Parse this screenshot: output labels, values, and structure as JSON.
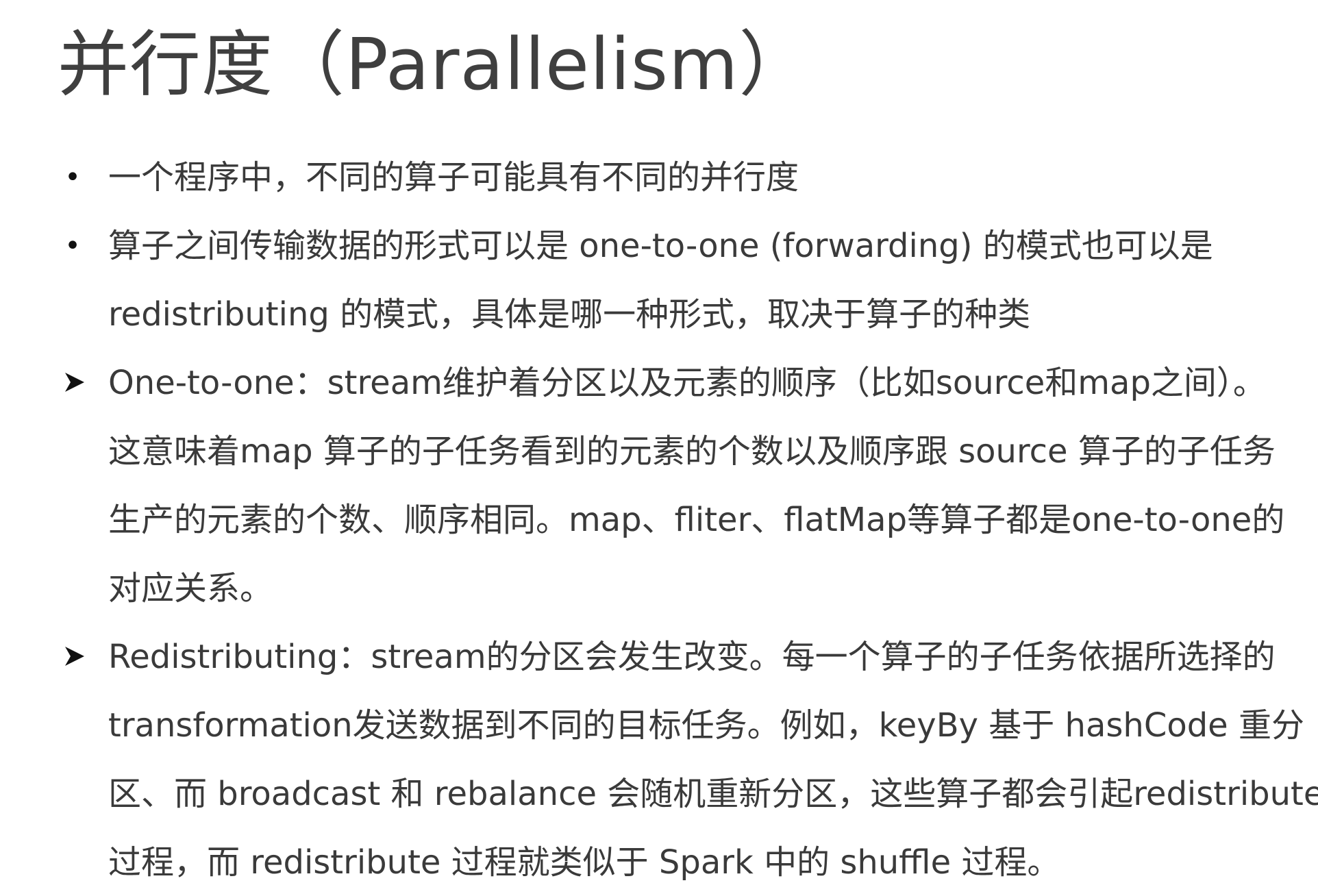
{
  "title": "并行度（Parallelism）",
  "items": [
    {
      "marker": "•",
      "lines": [
        "一个程序中，不同的算子可能具有不同的并行度"
      ]
    },
    {
      "marker": "•",
      "lines": [
        "算子之间传输数据的形式可以是 one-to-one (forwarding) 的模式也可以是",
        "redistributing 的模式，具体是哪一种形式，取决于算子的种类"
      ]
    },
    {
      "marker": "➢",
      "lines": [
        "One-to-one：stream维护着分区以及元素的顺序（比如source和map之间）。",
        "这意味着map 算子的子任务看到的元素的个数以及顺序跟 source 算子的子任务",
        "生产的元素的个数、顺序相同。map、fliter、flatMap等算子都是one-to-one的",
        "对应关系。"
      ]
    },
    {
      "marker": "➢",
      "lines": [
        "Redistributing：stream的分区会发生改变。每一个算子的子任务依据所选择的",
        "transformation发送数据到不同的目标任务。例如，keyBy 基于 hashCode 重分",
        "区、而 broadcast 和 rebalance 会随机重新分区，这些算子都会引起redistribute",
        "过程，而 redistribute 过程就类似于 Spark 中的 shuffle 过程。"
      ]
    }
  ]
}
